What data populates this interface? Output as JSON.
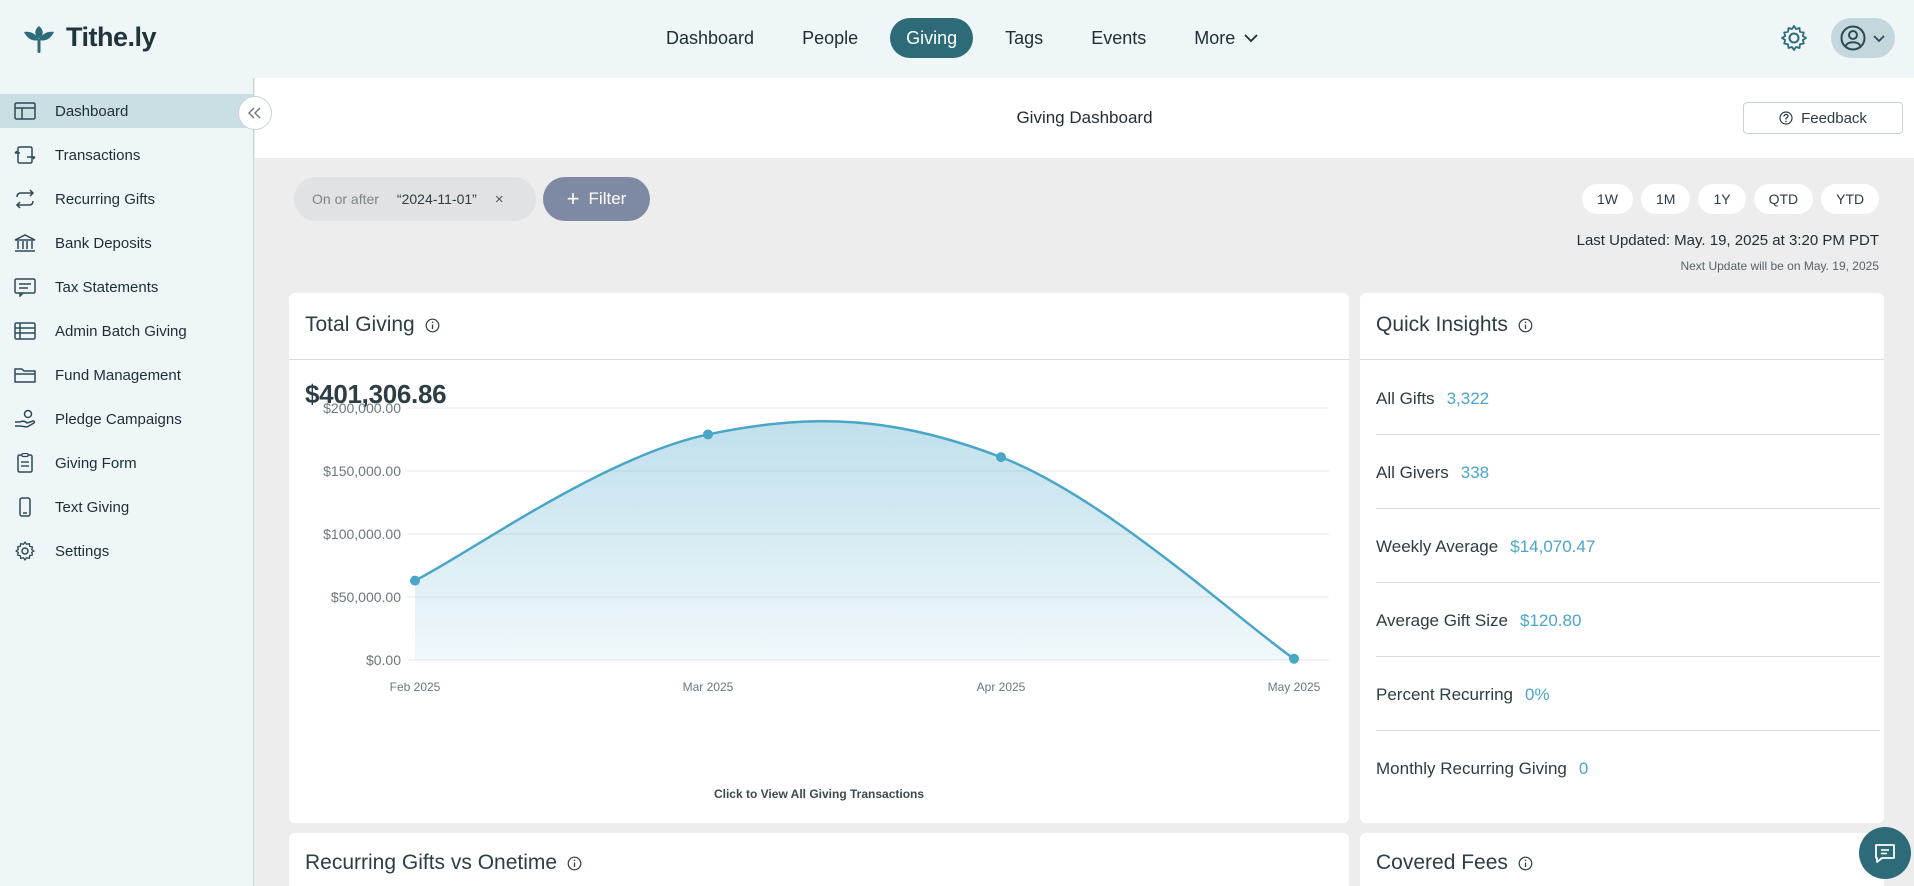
{
  "brand": {
    "name": "Tithe.ly",
    "accent": "#2d6b79"
  },
  "top_nav": {
    "items": [
      "Dashboard",
      "People",
      "Giving",
      "Tags",
      "Events"
    ],
    "more_label": "More",
    "active": "Giving"
  },
  "sidebar": {
    "items": [
      {
        "label": "Dashboard",
        "icon": "layout-icon"
      },
      {
        "label": "Transactions",
        "icon": "transactions-icon"
      },
      {
        "label": "Recurring Gifts",
        "icon": "recurring-icon"
      },
      {
        "label": "Bank Deposits",
        "icon": "bank-icon"
      },
      {
        "label": "Tax Statements",
        "icon": "statement-icon"
      },
      {
        "label": "Admin Batch Giving",
        "icon": "batch-icon"
      },
      {
        "label": "Fund Management",
        "icon": "folder-icon"
      },
      {
        "label": "Pledge Campaigns",
        "icon": "pledge-icon"
      },
      {
        "label": "Giving Form",
        "icon": "clipboard-icon"
      },
      {
        "label": "Text Giving",
        "icon": "phone-icon"
      },
      {
        "label": "Settings",
        "icon": "gear-icon"
      }
    ]
  },
  "header": {
    "title": "Giving Dashboard",
    "feedback_label": "Feedback"
  },
  "filters": {
    "chip_label": "On or after",
    "chip_value": "“2024-11-01”",
    "remove": "×",
    "add_label": "Filter"
  },
  "ranges": [
    "1W",
    "1M",
    "1Y",
    "QTD",
    "YTD"
  ],
  "updates": {
    "last": "Last Updated: May. 19, 2025 at 3:20 PM PDT",
    "next": "Next Update will be on May. 19, 2025"
  },
  "total_giving": {
    "title": "Total Giving",
    "amount": "$401,306.86",
    "link": "Click to View All Giving Transactions"
  },
  "chart_data": {
    "type": "area",
    "categories": [
      "Feb 2025",
      "Mar 2025",
      "Apr 2025",
      "May 2025"
    ],
    "values": [
      63000,
      179000,
      161000,
      1000
    ],
    "ylim": [
      0,
      200000
    ],
    "yticks": [
      "$0.00",
      "$50,000.00",
      "$100,000.00",
      "$150,000.00",
      "$200,000.00"
    ],
    "ytick_values": [
      0,
      50000,
      100000,
      150000,
      200000
    ],
    "color": "#4aa6c8",
    "grid": true
  },
  "quick_insights": {
    "title": "Quick Insights",
    "items": [
      {
        "label": "All Gifts",
        "value": "3,322"
      },
      {
        "label": "All Givers",
        "value": "338"
      },
      {
        "label": "Weekly Average",
        "value": "$14,070.47"
      },
      {
        "label": "Average Gift Size",
        "value": "$120.80"
      },
      {
        "label": "Percent Recurring",
        "value": "0%"
      },
      {
        "label": "Monthly Recurring Giving",
        "value": "0"
      }
    ]
  },
  "bottom_cards": {
    "left_title": "Recurring Gifts vs Onetime",
    "right_title": "Covered Fees"
  }
}
